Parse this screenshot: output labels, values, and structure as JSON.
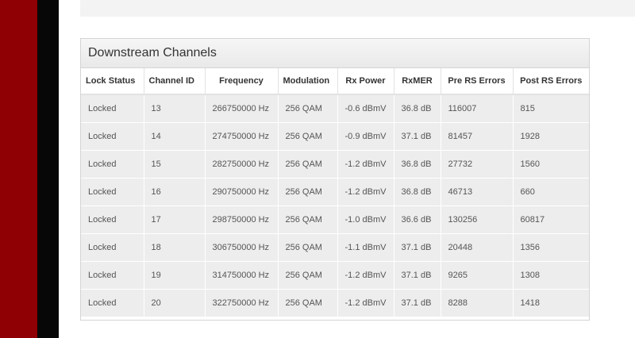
{
  "panel": {
    "title": "Downstream Channels"
  },
  "table": {
    "headers": [
      "Lock Status",
      "Channel ID",
      "Frequency",
      "Modulation",
      "Rx Power",
      "RxMER",
      "Pre RS Errors",
      "Post RS Errors"
    ],
    "rows": [
      [
        "Locked",
        "13",
        "266750000 Hz",
        "256 QAM",
        "-0.6 dBmV",
        "36.8 dB",
        "116007",
        "815"
      ],
      [
        "Locked",
        "14",
        "274750000 Hz",
        "256 QAM",
        "-0.9 dBmV",
        "37.1 dB",
        "81457",
        "1928"
      ],
      [
        "Locked",
        "15",
        "282750000 Hz",
        "256 QAM",
        "-1.2 dBmV",
        "36.8 dB",
        "27732",
        "1560"
      ],
      [
        "Locked",
        "16",
        "290750000 Hz",
        "256 QAM",
        "-1.2 dBmV",
        "36.8 dB",
        "46713",
        "660"
      ],
      [
        "Locked",
        "17",
        "298750000 Hz",
        "256 QAM",
        "-1.0 dBmV",
        "36.6 dB",
        "130256",
        "60817"
      ],
      [
        "Locked",
        "18",
        "306750000 Hz",
        "256 QAM",
        "-1.1 dBmV",
        "37.1 dB",
        "20448",
        "1356"
      ],
      [
        "Locked",
        "19",
        "314750000 Hz",
        "256 QAM",
        "-1.2 dBmV",
        "37.1 dB",
        "9265",
        "1308"
      ],
      [
        "Locked",
        "20",
        "322750000 Hz",
        "256 QAM",
        "-1.2 dBmV",
        "37.1 dB",
        "8288",
        "1418"
      ]
    ]
  },
  "colors": {
    "sidebar_red": "#8e0003",
    "sidebar_black": "#070707",
    "row_background": "#ededed"
  }
}
